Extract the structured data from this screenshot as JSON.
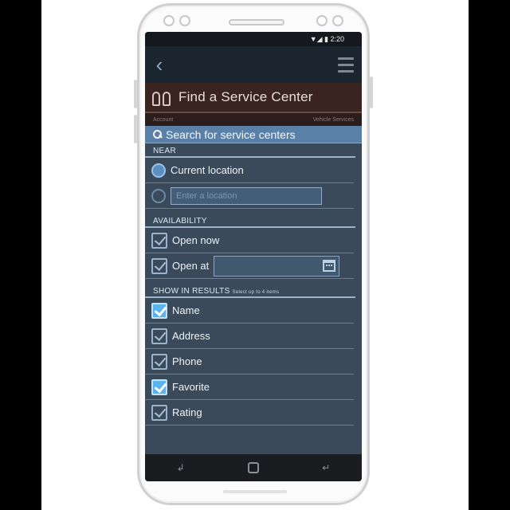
{
  "status": {
    "icons": "▼◢ ▮ 2:20"
  },
  "appbar": {
    "back_glyph": "‹"
  },
  "title": {
    "text": "Find a Service Center"
  },
  "subbar": {
    "left": "Account",
    "right": "Vehicle Services"
  },
  "search": {
    "label": "Search for service centers"
  },
  "near": {
    "section": "NEAR",
    "current_location": "Current location",
    "location_placeholder": "Enter a location"
  },
  "availability": {
    "section": "AVAILABILITY",
    "open_now": "Open now",
    "open_at": "Open at"
  },
  "results": {
    "section": "SHOW IN RESULTS",
    "hint": "Select up to 4 items",
    "items": [
      {
        "label": "Name",
        "checked": true
      },
      {
        "label": "Address",
        "checked": false
      },
      {
        "label": "Phone",
        "checked": false
      },
      {
        "label": "Favorite",
        "checked": true
      },
      {
        "label": "Rating",
        "checked": false
      }
    ]
  },
  "nav": {
    "back": "↵",
    "recents": "↲"
  },
  "colors": {
    "screen_bg": "#3a4a5a",
    "accent": "#5cb3ec",
    "title_bg": "#3a2422"
  }
}
